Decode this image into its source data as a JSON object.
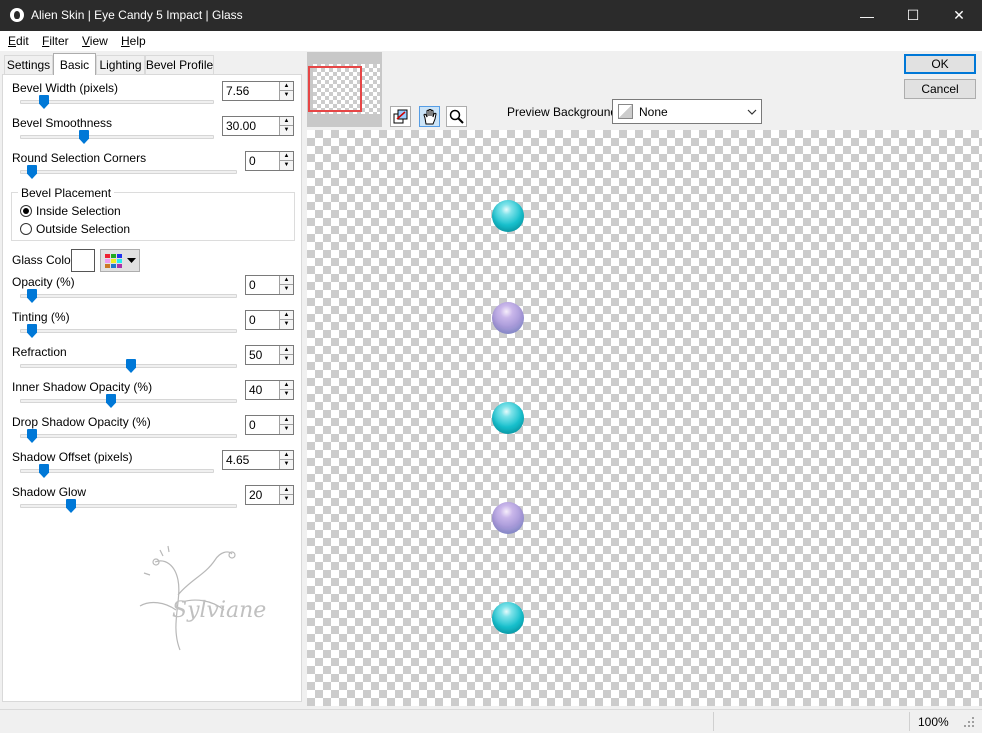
{
  "window": {
    "title": "Alien Skin | Eye Candy 5 Impact | Glass",
    "minimize": "—",
    "maximize": "☐",
    "close": "✕"
  },
  "menu": [
    {
      "label": "Edit",
      "mnemonic": "E",
      "rest": "dit"
    },
    {
      "label": "Filter",
      "mnemonic": "F",
      "rest": "ilter"
    },
    {
      "label": "View",
      "mnemonic": "V",
      "rest": "iew"
    },
    {
      "label": "Help",
      "mnemonic": "H",
      "rest": "elp"
    }
  ],
  "tabs": [
    "Settings",
    "Basic",
    "Lighting",
    "Bevel Profile"
  ],
  "active_tab": "Basic",
  "controls": {
    "bevel_width": {
      "label": "Bevel Width (pixels)",
      "value": "7.56",
      "slider": 0.07
    },
    "bevel_smoothness": {
      "label": "Bevel Smoothness",
      "value": "30.00",
      "slider": 0.3
    },
    "round_corners": {
      "label": "Round Selection Corners",
      "value": "0",
      "slider": 0.0
    },
    "bevel_placement": {
      "label": "Bevel Placement",
      "inside": "Inside Selection",
      "outside": "Outside Selection",
      "selected": "inside"
    },
    "glass_color": {
      "label": "Glass Color",
      "swatch": "#ffffff"
    },
    "opacity": {
      "label": "Opacity (%)",
      "value": "0",
      "slider": 0.0
    },
    "tinting": {
      "label": "Tinting (%)",
      "value": "0",
      "slider": 0.0
    },
    "refraction": {
      "label": "Refraction",
      "value": "50",
      "slider": 0.5
    },
    "inner_shadow_opacity": {
      "label": "Inner Shadow Opacity (%)",
      "value": "40",
      "slider": 0.4
    },
    "drop_shadow_opacity": {
      "label": "Drop Shadow Opacity (%)",
      "value": "0",
      "slider": 0.0
    },
    "shadow_offset": {
      "label": "Shadow Offset (pixels)",
      "value": "4.65",
      "slider": 0.07
    },
    "shadow_glow": {
      "label": "Shadow Glow",
      "value": "20",
      "slider": 0.2
    }
  },
  "watermark": "Sylviane",
  "buttons": {
    "ok": "OK",
    "cancel": "Cancel"
  },
  "preview_background": {
    "label": "Preview Background:",
    "value": "None"
  },
  "status": {
    "zoom": "100%"
  },
  "colors": {
    "accent": "#0078d7",
    "bead_teal": "#17c0cd",
    "bead_lilac": "#a89ad9"
  }
}
